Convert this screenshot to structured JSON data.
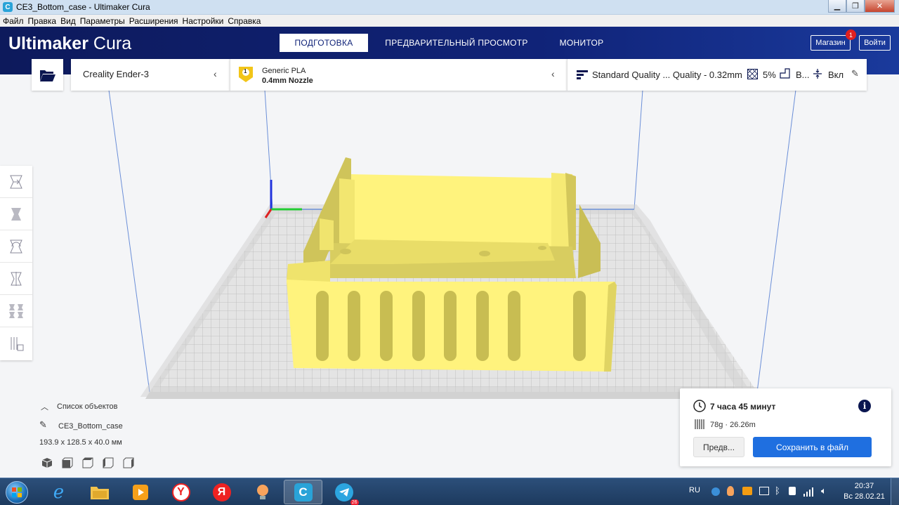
{
  "window": {
    "title": "CE3_Bottom_case - Ultimaker Cura",
    "app_icon_letter": "C"
  },
  "menu": [
    "Файл",
    "Правка",
    "Вид",
    "Параметры",
    "Расширения",
    "Настройки",
    "Справка"
  ],
  "header": {
    "logo_bold": "Ultimaker",
    "logo_light": "Cura",
    "tabs": [
      {
        "label": "ПОДГОТОВКА",
        "active": true
      },
      {
        "label": "ПРЕДВАРИТЕЛЬНЫЙ ПРОСМОТР",
        "active": false
      },
      {
        "label": "МОНИТОР",
        "active": false
      }
    ],
    "market_label": "Магазин",
    "market_badge": "1",
    "login_label": "Войти"
  },
  "toolbar": {
    "printer": "Creality Ender-3",
    "material_badge": "1",
    "material_name": "Generic PLA",
    "nozzle": "0.4mm Nozzle",
    "quality": "Standard Quality ... Quality - 0.32mm",
    "infill": "5%",
    "support": "В...",
    "adhesion": "Вкл"
  },
  "objects": {
    "list_title": "Список объектов",
    "name": "CE3_Bottom_case",
    "dimensions": "193.9 x 128.5 x 40.0 мм"
  },
  "print_info": {
    "time": "7 часа 45 минут",
    "material": "78g · 26.26m",
    "preview_label": "Предв...",
    "save_label": "Сохранить в файл"
  },
  "taskbar": {
    "language": "RU",
    "telegram_badge": "26",
    "time": "20:37",
    "date": "Вс 28.02.21"
  },
  "colors": {
    "header": "#102378",
    "accent": "#1f6fe0",
    "model": "#fff37d",
    "model_shade": "#d6cb5c"
  }
}
